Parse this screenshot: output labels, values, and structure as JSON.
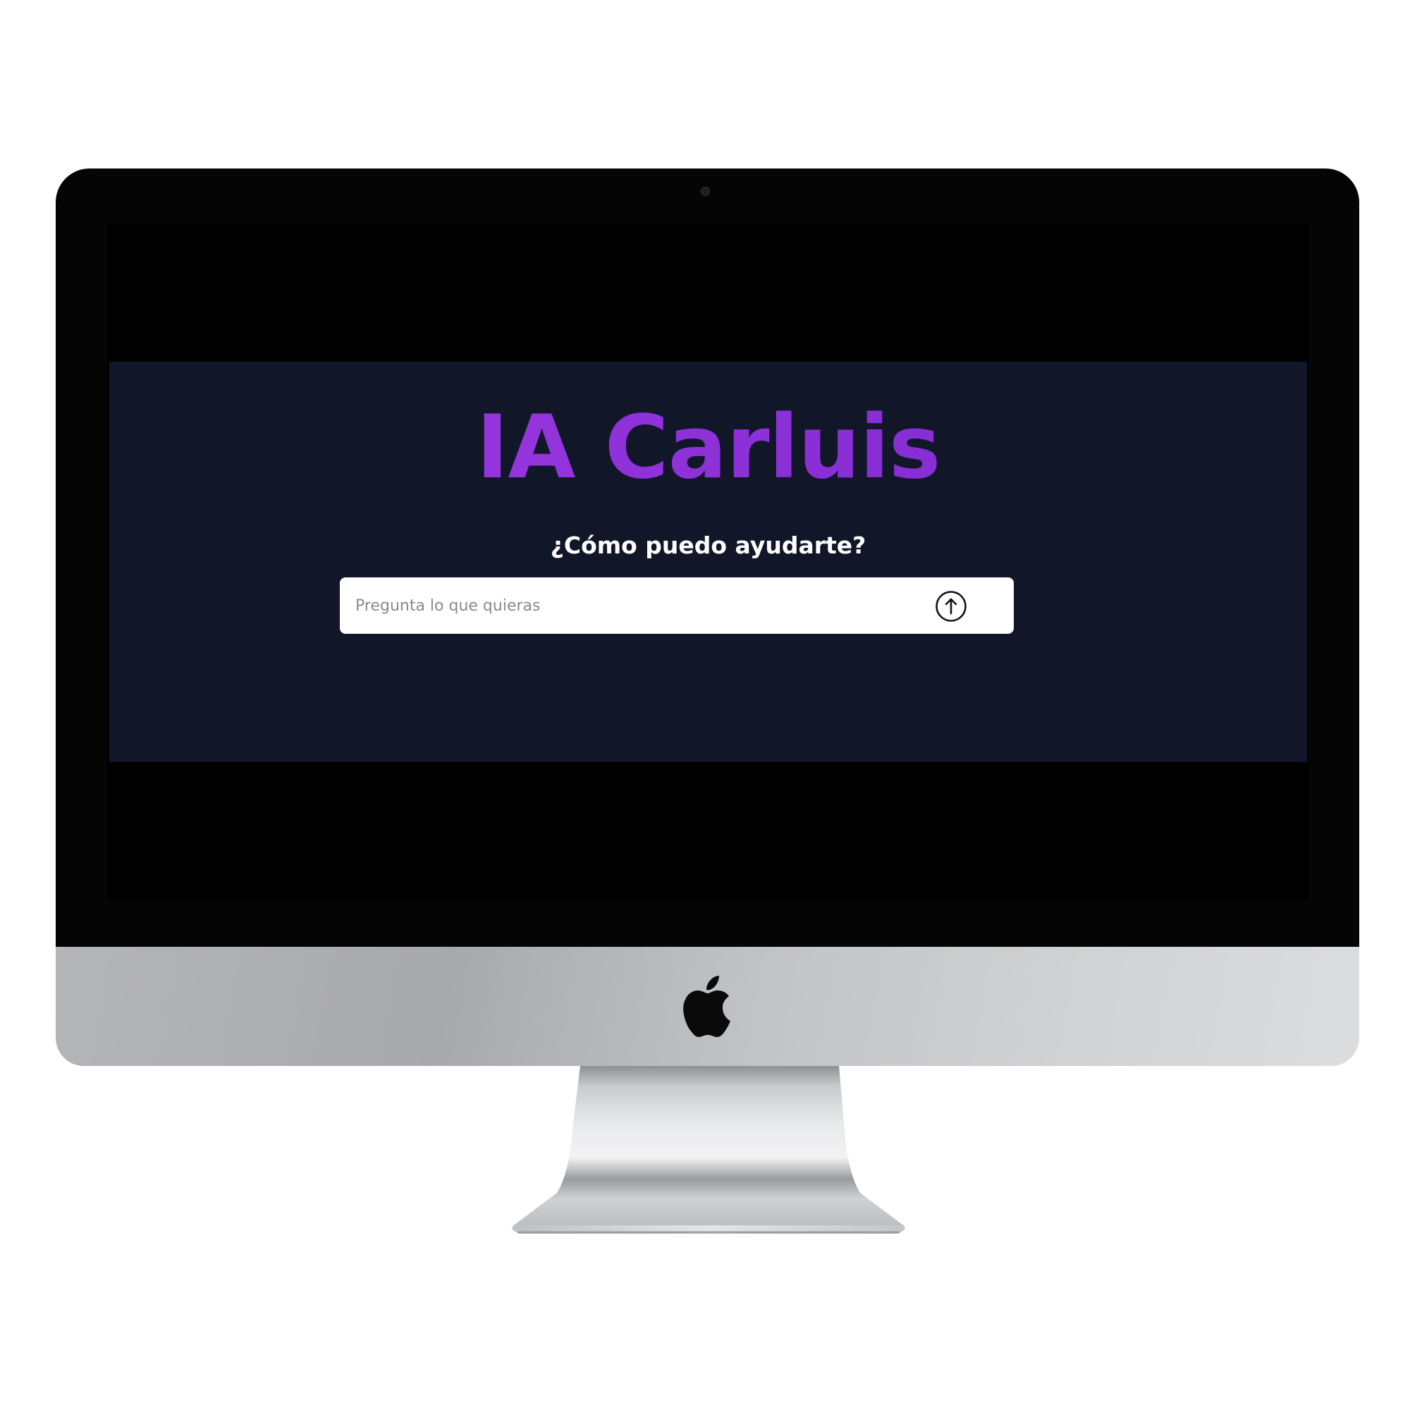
{
  "app": {
    "title": "IA Carluis",
    "subtitle": "¿Cómo puedo ayudarte?",
    "title_color": "#8a2fd6",
    "background_color": "#111729"
  },
  "search": {
    "placeholder": "Pregunta lo que quieras",
    "value": "",
    "send_icon": "arrow-up-circle-icon"
  },
  "device": {
    "type": "imac-mockup",
    "logo_icon": "apple-logo-icon"
  }
}
